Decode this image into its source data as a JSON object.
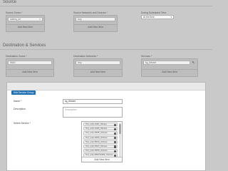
{
  "source": {
    "title": "Source",
    "zones": {
      "label": "Source Zones *",
      "value": "adsinq_int",
      "add": "Add New Item"
    },
    "networks": {
      "label": "Source Networks and Devices *",
      "value": "Any",
      "add": "Add New Item"
    },
    "schedule": {
      "label": "During Scheduled Time",
      "value": "At the time"
    }
  },
  "dest": {
    "title": "Destination & Services",
    "zones": {
      "label": "Destination Zones *",
      "value": "WAN",
      "add": "Add New Item"
    },
    "networks": {
      "label": "Destination Networks *",
      "value": "Any",
      "add": "Add New Item"
    },
    "services": {
      "label": "Services *",
      "value": "sg_tblcare",
      "add": "Add New Item"
    }
  },
  "panel": {
    "tab": "Edit Service Group",
    "name_label": "Name *",
    "name_value": "sg_tblcare",
    "desc_label": "Description",
    "desc_placeholder": "Description",
    "select_label": "Select Service *",
    "services": [
      "Tcp_udp-1110_tblcare",
      "Tcp_udp-1120_tblcare",
      "Tcp_udp-3535_tblcare",
      "Tcp_udp-4000_tblcare",
      "Tcp_udp-5010_tblcare",
      "Tcp_udp-5110_tblcare",
      "Tcp_udp-5350_tblcare",
      "Tcp_udp-8383-8384_tblcare"
    ],
    "add": "Add New Item"
  }
}
